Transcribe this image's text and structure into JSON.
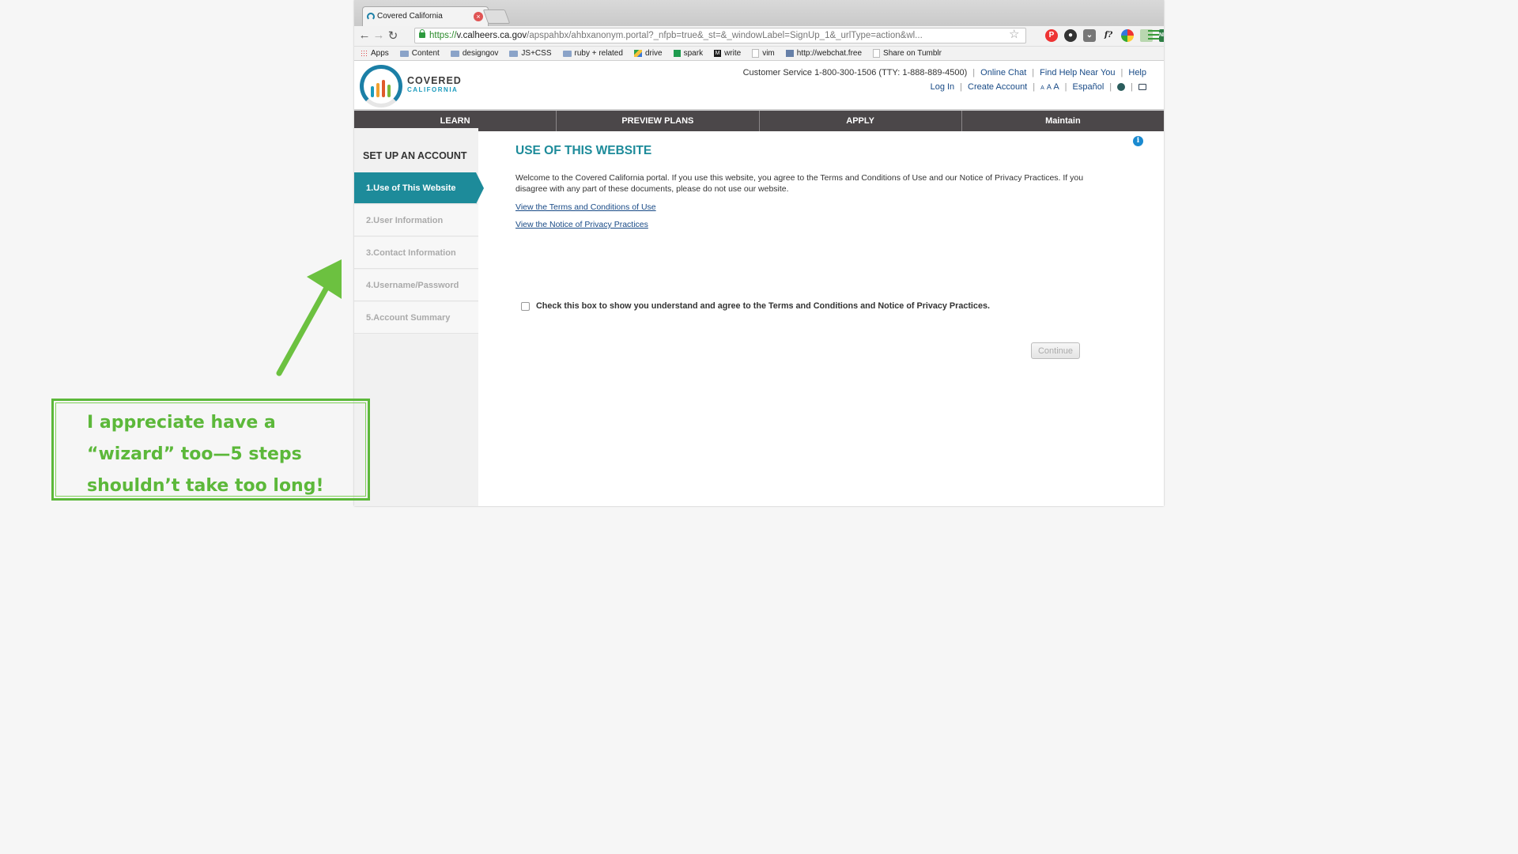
{
  "browser": {
    "tab_title": "Covered California",
    "url_scheme": "https://",
    "url_host": "v.calheers.ca.gov",
    "url_path": "/apspahbx/ahbxanonym.portal?_nfpb=true&_st=&_windowLabel=SignUp_1&_urlType=action&wl...",
    "extensions": [
      "pinterest-icon",
      "camera-icon",
      "pocket-icon",
      "fx-icon",
      "chrome-color-icon",
      "copy-icon",
      "new-icon",
      "iq-icon"
    ],
    "bookmarks": [
      {
        "label": "Apps",
        "icon": "apps-grid-icon"
      },
      {
        "label": "Content",
        "icon": "folder-icon"
      },
      {
        "label": "designgov",
        "icon": "folder-icon"
      },
      {
        "label": "JS+CSS",
        "icon": "folder-icon"
      },
      {
        "label": "ruby + related",
        "icon": "folder-icon"
      },
      {
        "label": "drive",
        "icon": "drive-icon"
      },
      {
        "label": "spark",
        "icon": "sheet-icon"
      },
      {
        "label": "write",
        "icon": "m-icon"
      },
      {
        "label": "vim",
        "icon": "page-icon"
      },
      {
        "label": "http://webchat.free",
        "icon": "image-icon"
      },
      {
        "label": "Share on Tumblr",
        "icon": "page-icon"
      }
    ]
  },
  "header": {
    "brand_line1": "COVERED",
    "brand_line2": "CALIFORNIA",
    "customer_service": "Customer Service 1-800-300-1506 (TTY: 1-888-889-4500)",
    "online_chat": "Online Chat",
    "find_help": "Find Help Near You",
    "help": "Help",
    "log_in": "Log In",
    "create_account": "Create Account",
    "text_size": [
      "A",
      "A",
      "A"
    ],
    "espanol": "Español"
  },
  "nav": [
    "LEARN",
    "PREVIEW PLANS",
    "APPLY",
    "Maintain"
  ],
  "sidebar": {
    "title": "SET UP AN ACCOUNT",
    "steps": [
      "1.Use of This Website",
      "2.User Information",
      "3.Contact Information",
      "4.Username/Password",
      "5.Account Summary"
    ],
    "active_step": 0
  },
  "main": {
    "title": "USE OF THIS WEBSITE",
    "intro": "Welcome to the Covered California portal. If you use this website, you agree to the Terms and Conditions of Use and our Notice of Privacy Practices. If you disagree with any part of these documents, please do not use our website.",
    "link_terms": "View the Terms and Conditions of Use",
    "link_privacy": "View the Notice of Privacy Practices",
    "agree_label": "Check this box to show you understand and agree to the Terms and Conditions and Notice of Privacy Practices.",
    "agree_checked": false,
    "continue_label": "Continue"
  },
  "annotation": {
    "text": "I appreciate have a “wizard” too—5 steps shouldn’t take too long!",
    "color": "#5cb83a"
  }
}
